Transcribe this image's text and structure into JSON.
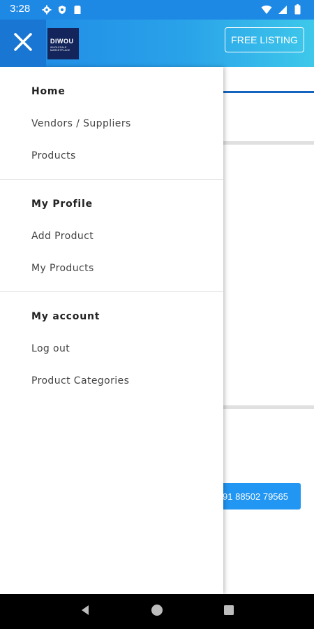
{
  "status_bar": {
    "time": "3:28",
    "left_icons": [
      "settings-icon",
      "shield-icon",
      "sim-card-icon"
    ],
    "right_icons": [
      "wifi-icon",
      "signal-icon",
      "battery-icon"
    ]
  },
  "header": {
    "logo_text": "DIWOU",
    "logo_subtext": "WHOLESALE MARKETPLACE",
    "free_listing_label": "FREE LISTING",
    "close_icon": "close-icon",
    "color_start": "#1e88e5",
    "color_end": "#3ec8ea"
  },
  "drawer": {
    "sections": [
      {
        "items": [
          {
            "label": "Home",
            "heading": true
          },
          {
            "label": "Vendors / Suppliers",
            "heading": false
          },
          {
            "label": "Products",
            "heading": false
          }
        ]
      },
      {
        "items": [
          {
            "label": "My Profile",
            "heading": true
          },
          {
            "label": "Add Product",
            "heading": false
          },
          {
            "label": "My Products",
            "heading": false
          }
        ]
      },
      {
        "items": [
          {
            "label": "My account",
            "heading": true
          },
          {
            "label": "Log out",
            "heading": false
          },
          {
            "label": "Product Categories",
            "heading": false
          }
        ]
      }
    ]
  },
  "background": {
    "phone_button": "91 88502 79565"
  },
  "nav_bar": {
    "buttons": [
      "back-icon",
      "home-icon",
      "recents-icon"
    ]
  }
}
